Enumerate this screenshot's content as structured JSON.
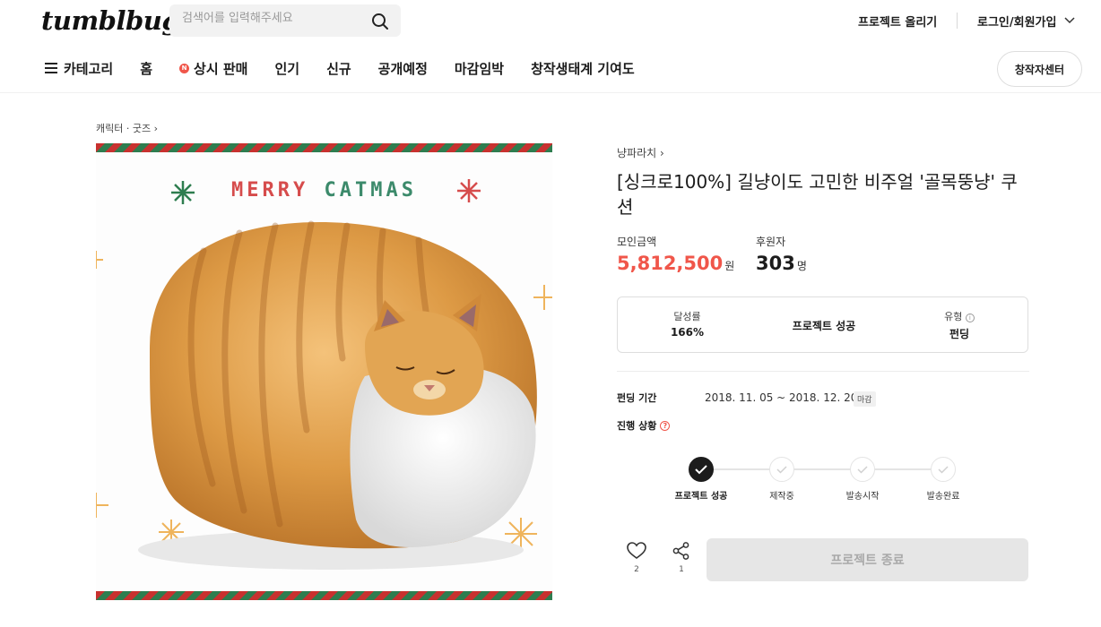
{
  "header": {
    "logo": "tumblbug",
    "search_placeholder": "검색어를 입력해주세요",
    "upload_project": "프로젝트 올리기",
    "login": "로그인/회원가입",
    "nav": [
      {
        "label": "카테고리",
        "icon": "hamburger-icon"
      },
      {
        "label": "홈"
      },
      {
        "label": "상시 판매",
        "badge": "N"
      },
      {
        "label": "인기"
      },
      {
        "label": "신규"
      },
      {
        "label": "공개예정"
      },
      {
        "label": "마감임박"
      },
      {
        "label": "창작생태계 기여도"
      }
    ],
    "creator_center": "창작자센터"
  },
  "breadcrumb": "캐릭터 · 굿즈",
  "hero": {
    "title_word1": "MERRY",
    "title_word2": "CATMAS"
  },
  "project": {
    "creator": "냥파라치",
    "title": "[싱크로100%] 길냥이도 고민한 비주얼 '골목뚱냥' 쿠션",
    "funding_label": "모인금액",
    "funding_amount": "5,812,500",
    "funding_unit": "원",
    "backers_label": "후원자",
    "backers_count": "303",
    "backers_unit": "명",
    "achievement_label": "달성률",
    "achievement_value": "166%",
    "status": "프로젝트 성공",
    "type_label": "유형",
    "type_value": "펀딩",
    "period_label": "펀딩 기간",
    "period_value": "2018. 11. 05 ~ 2018. 12. 20",
    "period_badge": "마감",
    "progress_label": "진행 상황",
    "steps": [
      {
        "label": "프로젝트 성공",
        "done": true
      },
      {
        "label": "제작중",
        "done": false
      },
      {
        "label": "발송시작",
        "done": false
      },
      {
        "label": "발송완료",
        "done": false
      }
    ],
    "likes": "2",
    "shares": "1",
    "end_button": "프로젝트 종료"
  },
  "colors": {
    "accent": "#f0564a",
    "ribbon_red": "#c8312f",
    "ribbon_green": "#2e7d4f"
  }
}
